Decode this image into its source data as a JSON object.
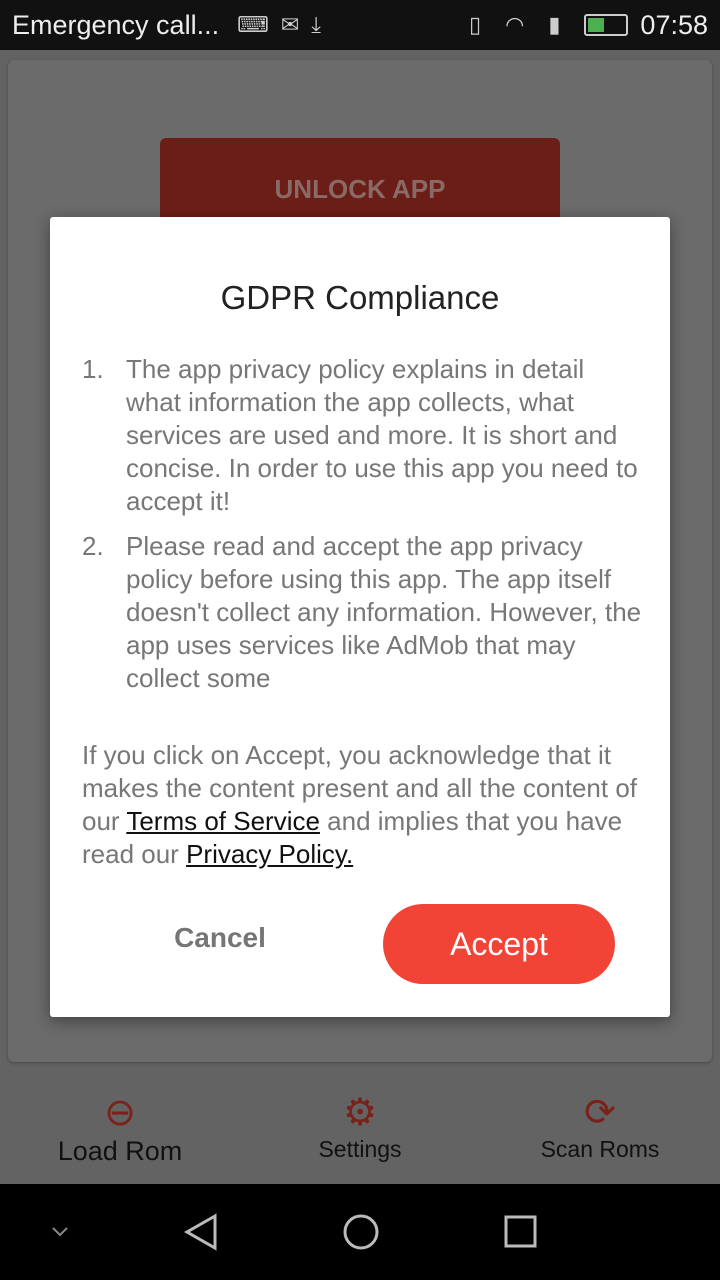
{
  "status_bar": {
    "title": "Emergency call...",
    "time": "07:58",
    "icons": [
      "keyboard-icon",
      "mail-icon",
      "download-icon",
      "vibrate-icon",
      "wifi-icon",
      "sim-alert-icon",
      "battery-charging-icon"
    ]
  },
  "background": {
    "unlock_label": "UNLOCK APP"
  },
  "bottom_nav": [
    {
      "label": "Load Rom",
      "icon": "link-icon"
    },
    {
      "label": "Settings",
      "icon": "gear-icon"
    },
    {
      "label": "Scan Roms",
      "icon": "refresh-icon"
    }
  ],
  "dialog": {
    "title": "GDPR Compliance",
    "items": [
      {
        "num": "1.",
        "text": "The app privacy policy explains in detail what information the app collects, what services are used and more. It is short and concise. In order to use this app you need to accept it!"
      },
      {
        "num": "2.",
        "text": "Please read and accept the app privacy policy before using this app. The app itself doesn't collect any information. However, the app uses services like AdMob that may collect some"
      }
    ],
    "para_1": "If you click on Accept, you acknowledge that it makes the content present and all the content of our ",
    "terms_link": "Terms of Service",
    "para_2": " and implies that you have read our ",
    "privacy_link": "Privacy Policy.",
    "cancel": "Cancel",
    "accept": "Accept"
  },
  "colors": {
    "accent": "#f14436",
    "dim_accent": "#7a2219"
  }
}
